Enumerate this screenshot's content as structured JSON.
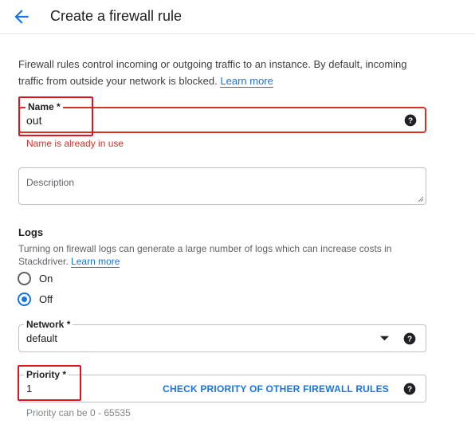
{
  "header": {
    "title": "Create a firewall rule"
  },
  "intro": {
    "text": "Firewall rules control incoming or outgoing traffic to an instance. By default, incoming traffic from outside your network is blocked.",
    "learn_more": "Learn more"
  },
  "name_field": {
    "label": "Name",
    "required_mark": "*",
    "value": "out",
    "error": "Name is already in use"
  },
  "description_field": {
    "placeholder": "Description"
  },
  "logs": {
    "title": "Logs",
    "description": "Turning on firewall logs can generate a large number of logs which can increase costs in Stackdriver.",
    "learn_more": "Learn more",
    "options": [
      {
        "label": "On",
        "checked": false
      },
      {
        "label": "Off",
        "checked": true
      }
    ]
  },
  "network_field": {
    "label": "Network",
    "required_mark": "*",
    "value": "default"
  },
  "priority_field": {
    "label": "Priority",
    "required_mark": "*",
    "value": "1",
    "check_link": "CHECK PRIORITY OF OTHER FIREWALL RULES",
    "hint": "Priority can be 0 - 65535"
  },
  "colors": {
    "accent": "#1a73e8",
    "error": "#d93025",
    "annotation": "#e0141e"
  },
  "icons": [
    "back-arrow-icon",
    "help-icon",
    "dropdown-arrow-icon"
  ]
}
